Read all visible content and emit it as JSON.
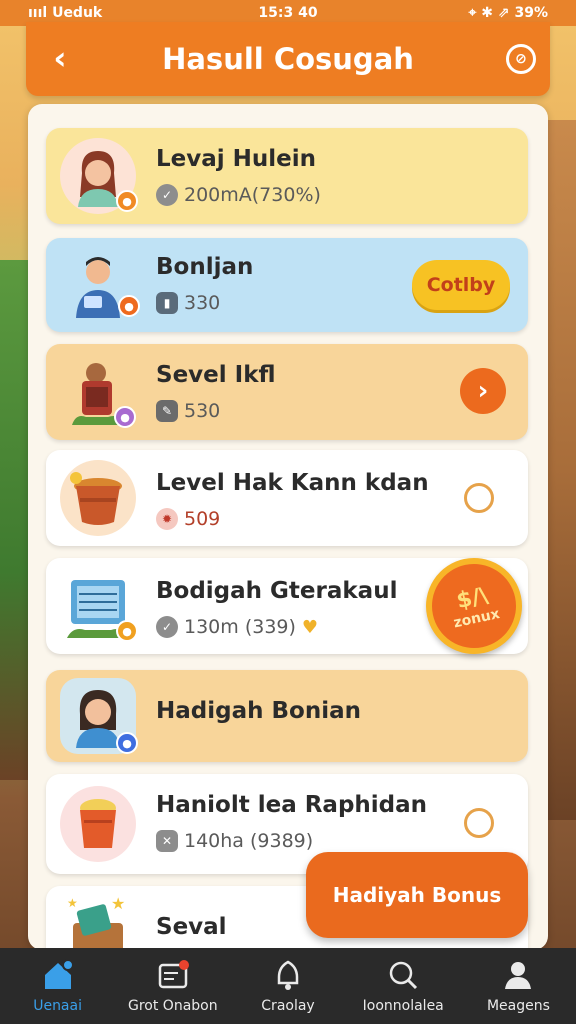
{
  "status": {
    "left": "ıııl Ueduk",
    "time": "15:3 40",
    "right": "⌖ ✱ ⇗ 39%"
  },
  "header": {
    "title": "Hasull Cosugah",
    "back_glyph": "‹",
    "edit_glyph": "⊘"
  },
  "cards": [
    {
      "name": "Levaj Hulein",
      "sub": "200mA(730%)",
      "bg": "#fae59a",
      "action": "none"
    },
    {
      "name": "Bonljan",
      "sub": "330",
      "bg": "#bfe2f5",
      "action": "pill",
      "action_label": "Cotlby"
    },
    {
      "name": "Sevel Ikfl",
      "sub": "530",
      "bg": "#f8d59a",
      "action": "arrow",
      "action_label": "›"
    },
    {
      "name": "Level Hak Kann kdan",
      "sub": "509",
      "bg": "#ffffff",
      "action": "radio"
    },
    {
      "name": "Bodigah Gterakaul",
      "sub": "130m (339)",
      "bg": "#ffffff",
      "action": "coin"
    },
    {
      "name": "Hadigah Bonian",
      "sub": "",
      "bg": "#f8d59a",
      "action": "none"
    },
    {
      "name": "Haniolt lea Raphidan",
      "sub": "140ha (9389)",
      "bg": "#ffffff",
      "action": "radio"
    },
    {
      "name": "Seval",
      "sub": "",
      "bg": "#ffffff",
      "action": "none"
    }
  ],
  "coin": {
    "top": "$/\\",
    "bottom": "zonux"
  },
  "fab": {
    "label": "Hadiyah Bonus"
  },
  "tabs": [
    {
      "label": "Uenaai",
      "icon": "home-icon",
      "active": true
    },
    {
      "label": "Grot Onabon",
      "icon": "inbox-icon",
      "active": false
    },
    {
      "label": "Craolay",
      "icon": "bell-icon",
      "active": false
    },
    {
      "label": "Ioonnolalea",
      "icon": "search-icon",
      "active": false
    },
    {
      "label": "Meagens",
      "icon": "user-icon",
      "active": false
    }
  ]
}
